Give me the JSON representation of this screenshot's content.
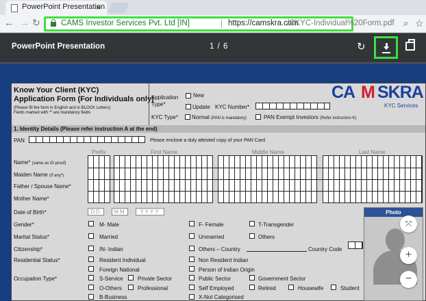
{
  "browser": {
    "tab_title": "PowerPoint Presentation",
    "url_site": "CAMS Investor Services Pvt. Ltd [IN]",
    "url_host": "https://camskra.com",
    "url_path": "/CKYC-Individual%20Form.pdf"
  },
  "viewer": {
    "title": "PowerPoint Presentation",
    "page": "1",
    "page_sep": "/",
    "page_total": "6"
  },
  "form": {
    "title1": "Know Your Client (KYC)",
    "title2": "Application Form (For Individuals only)",
    "note1": "(Please fill the form in English and in BLOCK Letters)",
    "note2": "Fields marked with '*' are mandatory fields",
    "app_type1": "Application",
    "app_type2": "Type*",
    "new": "New",
    "update": "Update",
    "kyc_number": "KYC Number*",
    "kyc_type": "KYC Type*",
    "normal": "Normal",
    "normal_note": "(PAN is mandatory)",
    "pan_exempt": "PAN Exempt Investors",
    "pan_exempt_note": "(Refer instruction K)",
    "logo_ca": "CA",
    "logo_m": "M",
    "logo_skra": "SKRA",
    "logo_sub": "KYC Services",
    "section1": "1. Identity Details (Please refer instruction A at the end)",
    "pan": "PAN",
    "pan_note": "Please enclose a duly attested copy of your PAN Card",
    "col_prefix": "Prefix",
    "col_first": "First Name",
    "col_middle": "Middle Name",
    "col_last": "Last Name",
    "name": "Name*",
    "name_note": "(same as ID proof)",
    "maiden": "Maiden Name",
    "maiden_note": "(If any*)",
    "father": "Father / Spouse Name*",
    "mother": "Mother Name*",
    "dob": "Date of Birth*",
    "dob_d": "DD",
    "dob_m": "MM",
    "dob_y": "YYYY",
    "gender": "Gender*",
    "male": "M- Male",
    "female": "F- Female",
    "trans": "T-Transgender",
    "marital": "Marital Status*",
    "married": "Married",
    "unmarried": "Unmarried",
    "others": "Others",
    "citizenship": "Citizenship*",
    "indian": "IN- Indian",
    "others_country": "Others – Country",
    "country_code": "Country Code",
    "residential": "Residential Status*",
    "resident": "Resident Individual",
    "nri": "Non Resident Indian",
    "foreign": "Foreign National",
    "pio": "Person of Indian Origin",
    "occupation": "Occupation Type*",
    "s_service": "S-Service",
    "private": "Private Sector",
    "public": "Public Sector",
    "govt": "Government Sector",
    "o_others": "O-Others",
    "professional": "Professional",
    "self_emp": "Self Employed",
    "retired": "Retired",
    "housewife": "Housewife",
    "student": "Student",
    "b_business": "B-Business",
    "x_not": "X-Not Categorised",
    "photo": "Photo"
  },
  "colors": {
    "highlight": "#3ee03e",
    "logo_blue": "#1d3fa0",
    "logo_red": "#d0202a"
  }
}
